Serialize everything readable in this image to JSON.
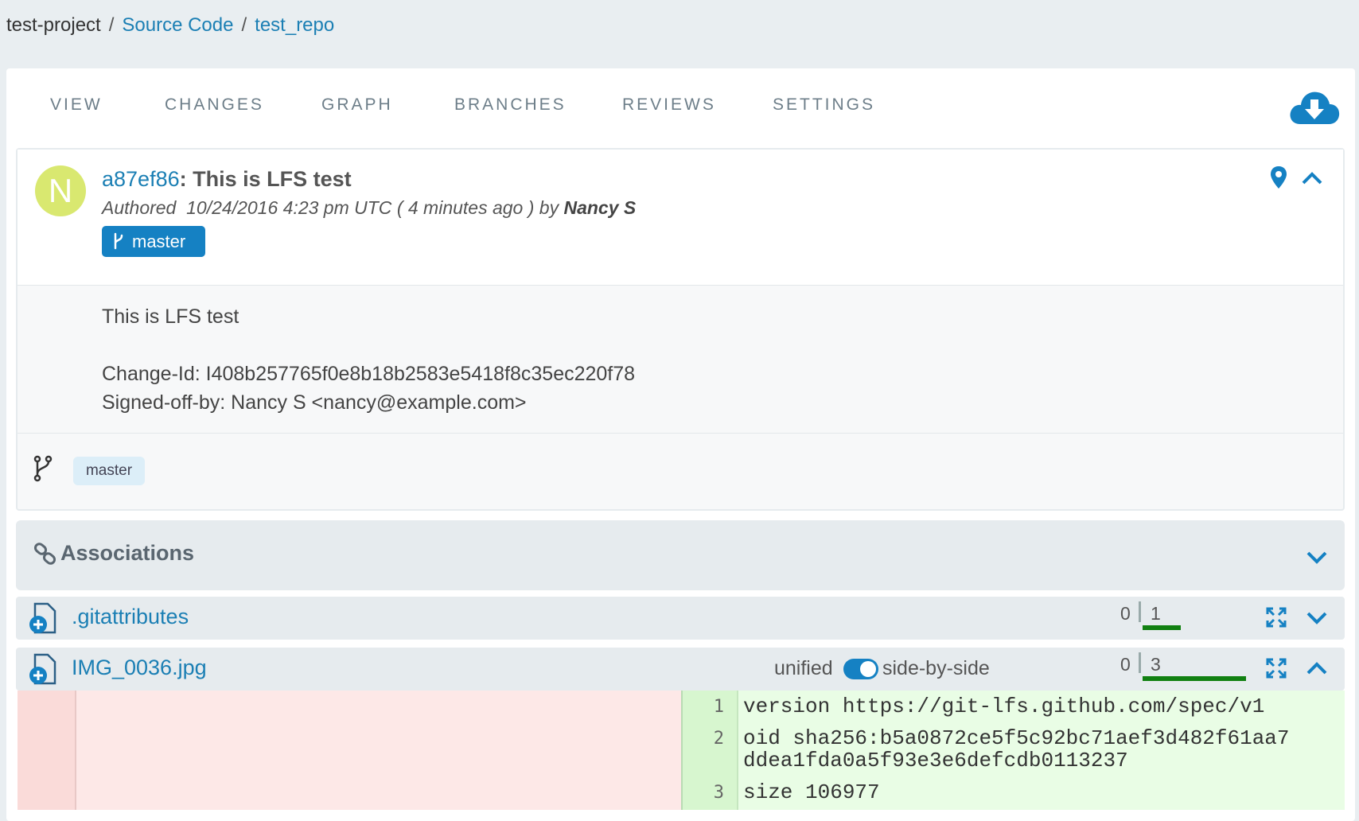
{
  "breadcrumb": {
    "project": "test-project",
    "section": "Source Code",
    "repo": "test_repo",
    "separator": "/"
  },
  "tabs": [
    "VIEW",
    "CHANGES",
    "GRAPH",
    "BRANCHES",
    "REVIEWS",
    "SETTINGS"
  ],
  "commit": {
    "avatar_letter": "N",
    "sha": "a87ef86",
    "title_sep": ": ",
    "title": "This is LFS test",
    "authored_prefix": "Authored",
    "date": "10/24/2016 4:23 pm UTC",
    "relative": "( 4 minutes ago )",
    "by": "by",
    "author": "Nancy S",
    "branch": "master",
    "message_line1": "This is LFS test",
    "change_id": "Change-Id: I408b257765f0e8b18b2583e5418f8c35ec220f78",
    "signed_off": "Signed-off-by: Nancy S <nancy@example.com>",
    "branch_tag": "master"
  },
  "associations": {
    "label": "Associations"
  },
  "files": [
    {
      "name": ".gitattributes",
      "removed": "0",
      "added": "1"
    },
    {
      "name": "IMG_0036.jpg",
      "removed": "0",
      "added": "3"
    }
  ],
  "diff_toggle": {
    "left": "unified",
    "right": "side-by-side",
    "state": "side-by-side"
  },
  "diff": {
    "lines": [
      {
        "num": "1",
        "text": "version https://git-lfs.github.com/spec/v1"
      },
      {
        "num": "2",
        "text": "oid sha256:b5a0872ce5f5c92bc71aef3d482f61aa7\nddea1fda0a5f93e3e6defcdb0113237"
      },
      {
        "num": "3",
        "text": "size 106977"
      }
    ]
  },
  "colors": {
    "accent": "#1581c3",
    "link": "#1b7fb4",
    "added_bar": "#118011"
  },
  "icons": [
    "cloud-download-icon",
    "map-pin-icon",
    "chevron-up-icon",
    "branch-icon",
    "link-icon",
    "chevron-down-icon",
    "file-add-icon",
    "expand-icon"
  ]
}
